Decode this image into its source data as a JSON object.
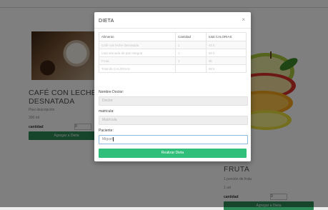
{
  "colors": {
    "primary_green": "#2fbf7a",
    "dark_green": "#2d8a58",
    "overlay": "rgba(0,0,0,0.5)",
    "focus_border": "#8fb7e0"
  },
  "background": {
    "cafe_card": {
      "image_icon": "coffee-cup-image",
      "title": "CAFÉ CON LECHE DESNATADA",
      "description": "Piso descripción",
      "price": "300 ml",
      "qty_label": "cantidad",
      "qty_value": "0",
      "add_button": "Agregar a Dieta"
    },
    "fruit_card": {
      "image_icon": "fruit-slices-image",
      "title": "FRUTA",
      "description": "1 porción de fruta",
      "price": "1 ud",
      "qty_label": "cantidad",
      "qty_value": "0",
      "add_button": "Agregar a Dieta"
    }
  },
  "modal": {
    "title": "DIETA",
    "close_icon": "close-icon",
    "close_glyph": "×",
    "table": {
      "headers": [
        "Alimento",
        "Cantidad",
        "total CALORIAS"
      ],
      "rows": [
        [
          "Café con leche desnatada",
          "1",
          "42 k"
        ],
        [
          "Lata atunada de pan integral",
          "1",
          "60 k"
        ],
        [
          "Fruta",
          "1",
          "5k"
        ],
        [
          "Total de CALORIAS",
          "",
          "90 k"
        ]
      ]
    },
    "fields": {
      "doctor": {
        "label": "Nombre Doctor:",
        "placeholder": "Doctor"
      },
      "matricula": {
        "label": "matricula:",
        "placeholder": "Matrícula"
      },
      "paciente": {
        "label": "Paciente:",
        "value": "Miguel"
      }
    },
    "submit_button": "Realizar Dieta"
  }
}
